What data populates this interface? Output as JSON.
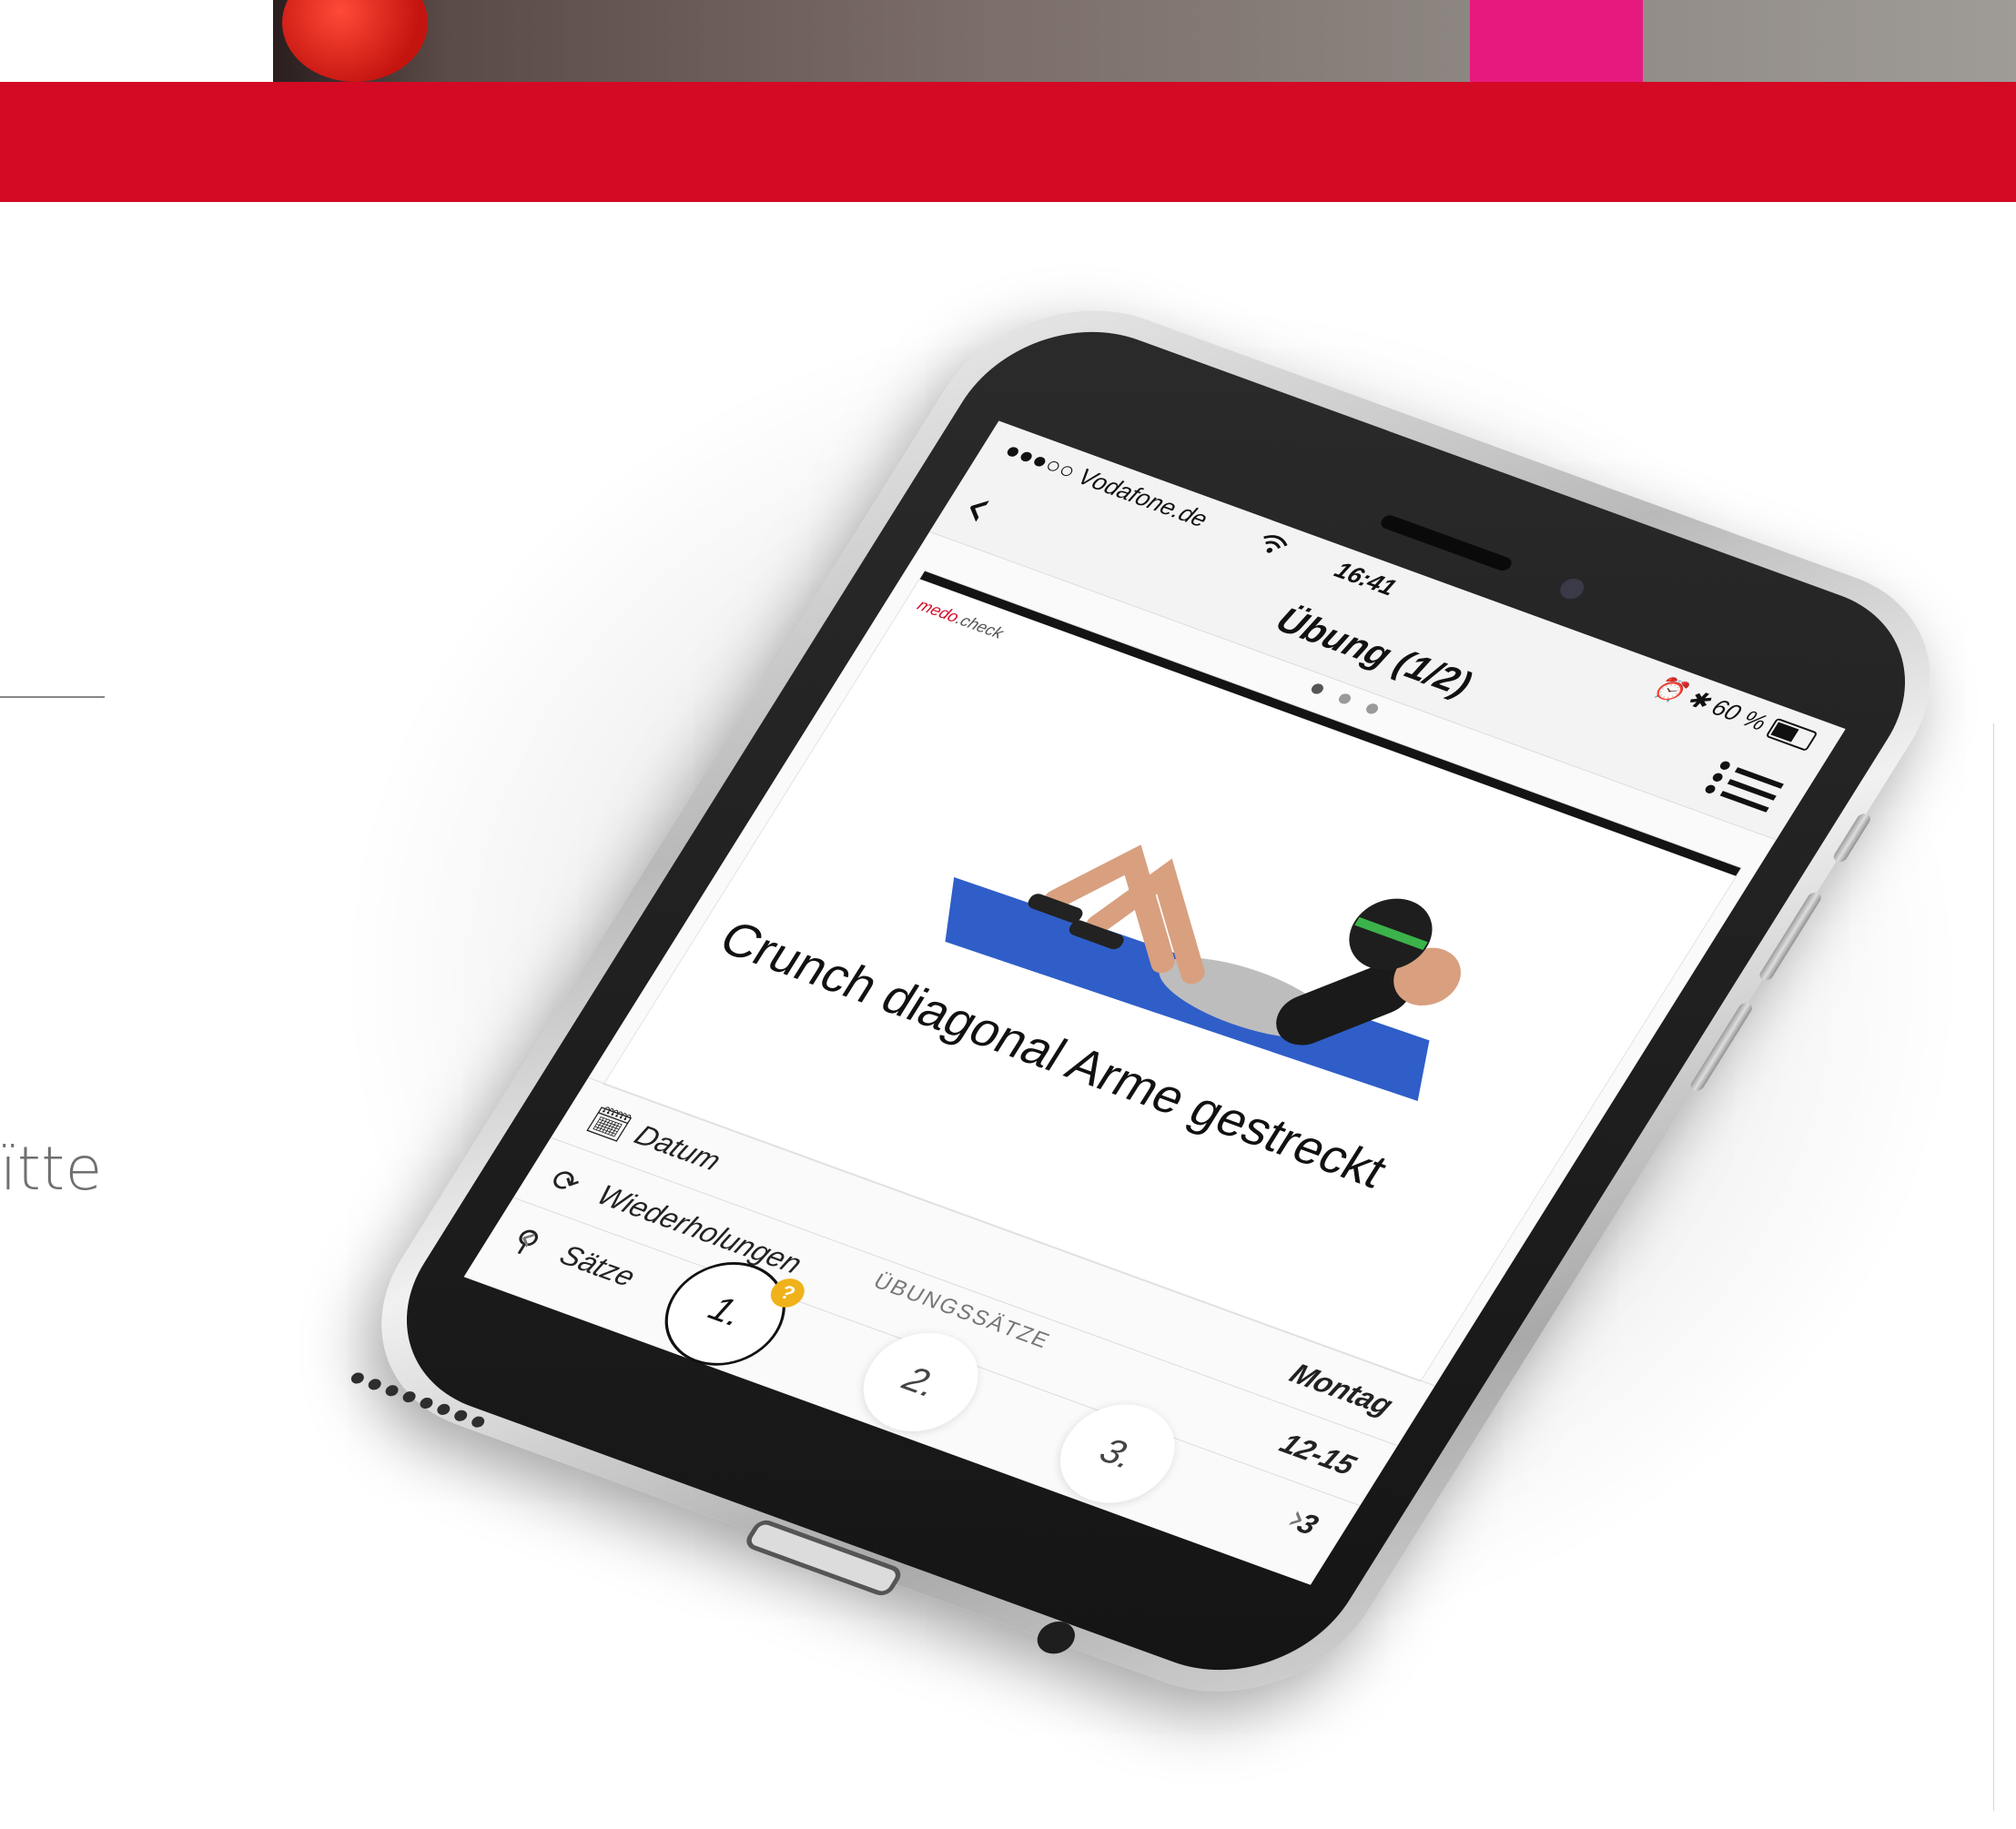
{
  "background": {
    "side_text": "ïtte"
  },
  "status_bar": {
    "carrier": "●●●○○ Vodafone.de",
    "wifi_icon": "wifi-icon",
    "time": "16:41",
    "right": "⏰ ✱ 60 %",
    "battery_level_percent": 60
  },
  "nav": {
    "back_icon": "chevron-left-icon",
    "title": "Übung (1/2)",
    "menu_icon": "list-menu-icon"
  },
  "pager": {
    "total": 3,
    "active": 1
  },
  "card": {
    "brand": "medo.check"
  },
  "exercise": {
    "title": "Crunch diagonal Arme gestreckt"
  },
  "details": [
    {
      "icon": "calendar-icon",
      "label": "Datum",
      "value": "Montag"
    },
    {
      "icon": "repeat-icon",
      "label": "Wiederholungen",
      "value": "12-15"
    },
    {
      "icon": "sets-icon",
      "label": "Sätze",
      "value": "3"
    }
  ],
  "sets": {
    "label": "ÜBUNGSSÄTZE",
    "items": [
      "1.",
      "2.",
      "3."
    ],
    "active_index": 0,
    "badge": "?"
  },
  "colors": {
    "brand_red": "#d40a25",
    "badge_yellow": "#f0b21a",
    "accent_pink": "#e6197f"
  }
}
